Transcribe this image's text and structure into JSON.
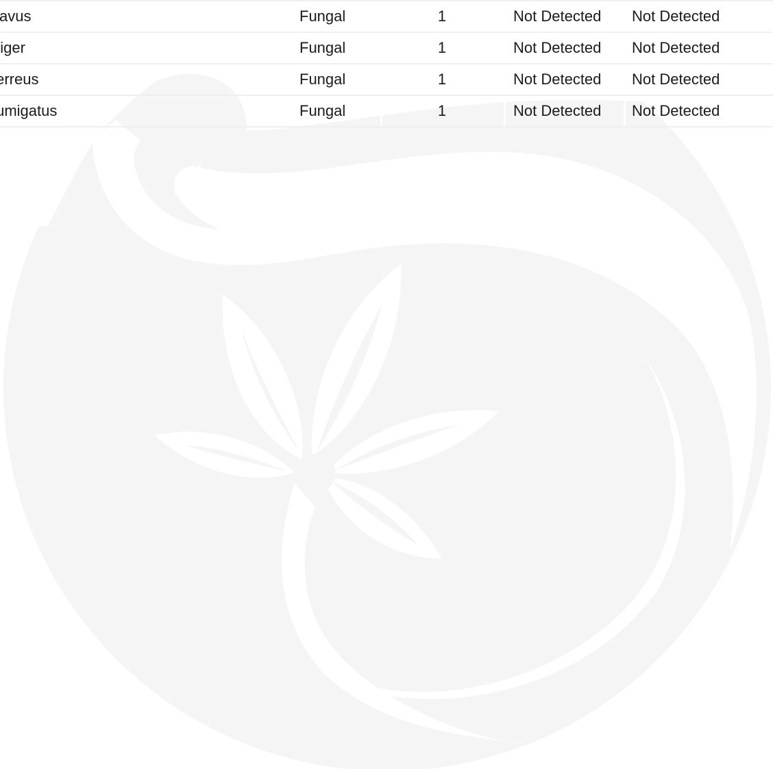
{
  "watermark": {
    "icon": "leaf-swirl-logo-icon",
    "color": "#f4f5f4"
  },
  "table": {
    "rows": [
      {
        "organism": "flavus",
        "type": "Fungal",
        "count": "1",
        "result_1": "Not Detected",
        "result_2": "Not Detected"
      },
      {
        "organism": "niger",
        "type": "Fungal",
        "count": "1",
        "result_1": "Not Detected",
        "result_2": "Not Detected"
      },
      {
        "organism": "terreus",
        "type": "Fungal",
        "count": "1",
        "result_1": "Not Detected",
        "result_2": "Not Detected"
      },
      {
        "organism": "fumigatus",
        "type": "Fungal",
        "count": "1",
        "result_1": "Not Detected",
        "result_2": "Not Detected"
      }
    ]
  }
}
